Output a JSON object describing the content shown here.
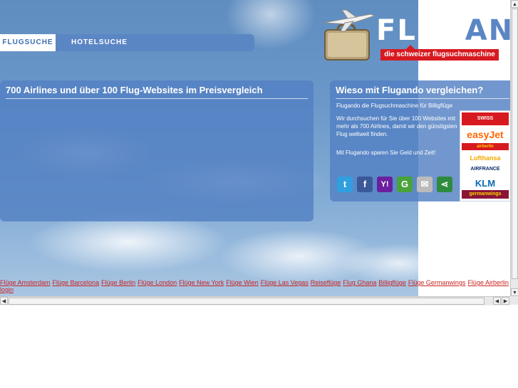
{
  "nav": {
    "tabs": [
      {
        "label": "FLUGSUCHE"
      },
      {
        "label": "HOTELSUCHE"
      }
    ]
  },
  "logo": {
    "word_white": "FLUG",
    "word_blue": "ANDO",
    "tagline": "die schweizer flugsuchmaschine"
  },
  "search_panel": {
    "title": "700 Airlines und über 100 Flug-Websites im Preisvergleich"
  },
  "about_panel": {
    "title": "Wieso mit Flugando vergleichen?",
    "subtitle": "Flugando die Flugsuchmaschine für Billigflüge",
    "paragraph1": "Wir durchsuchen für Sie über 100 Websites mit mehr als 700 Airlines, damit wir den günstigsten Flug weltweit finden.",
    "paragraph2": "Mit Flugando sparen Sie Geld und Zeit!"
  },
  "social": [
    {
      "name": "twitter-icon",
      "glyph": "t",
      "color": "#2f9fe0"
    },
    {
      "name": "facebook-icon",
      "glyph": "f",
      "color": "#3b5998"
    },
    {
      "name": "yahoo-icon",
      "glyph": "Y!",
      "color": "#6b1fa0"
    },
    {
      "name": "google-icon",
      "glyph": "G",
      "color": "#4aa33a"
    },
    {
      "name": "email-icon",
      "glyph": "✉",
      "color": "#bbbbbb"
    },
    {
      "name": "share-icon",
      "glyph": "⋖",
      "color": "#2e8b3e"
    }
  ],
  "airlines": {
    "swiss": "SWISS",
    "easyjet": "easyJet",
    "hellovia": "airberlin",
    "lufthansa": "Lufthansa",
    "airfrance": "AIRFRANCE",
    "klm": "KLM",
    "germanwings": "germanwings"
  },
  "footer_links": [
    "Flüge Amsterdam",
    "Flüge Barcelona",
    "Flüge Berlin",
    "Flüge London",
    "Flüge New York",
    "Flüge Wien",
    "Flüge Las Vegas",
    "Reiseflüge",
    "Flug Ghana",
    "Billigflüge",
    "Flüge Germanwings",
    "Flüge Airberlin",
    "login"
  ]
}
